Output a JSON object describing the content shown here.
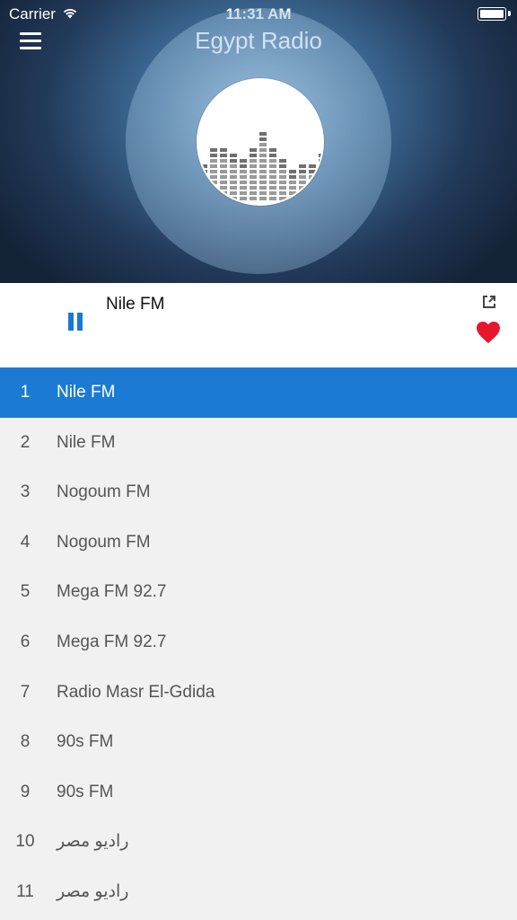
{
  "status_bar": {
    "carrier": "Carrier",
    "time": "11:31 AM"
  },
  "header": {
    "title": "Egypt Radio",
    "menu_icon": "hamburger-menu-icon",
    "logo": "equalizer-logo"
  },
  "player": {
    "now_playing": "Nile FM",
    "state": "playing",
    "pause_icon": "pause-icon",
    "share_icon": "external-link-icon",
    "favorite_icon": "heart-icon",
    "accent_color": "#1b7bd3",
    "favorite_color": "#e8162d"
  },
  "stations": [
    {
      "num": "1",
      "name": "Nile FM",
      "active": true
    },
    {
      "num": "2",
      "name": "Nile FM"
    },
    {
      "num": "3",
      "name": "Nogoum FM"
    },
    {
      "num": "4",
      "name": "Nogoum FM"
    },
    {
      "num": "5",
      "name": "Mega FM 92.7"
    },
    {
      "num": "6",
      "name": "Mega FM 92.7"
    },
    {
      "num": "7",
      "name": "Radio Masr El-Gdida"
    },
    {
      "num": "8",
      "name": "90s FM"
    },
    {
      "num": "9",
      "name": "90s FM"
    },
    {
      "num": "10",
      "name": "راديو مصر"
    },
    {
      "num": "11",
      "name": "راديو مصر"
    }
  ]
}
